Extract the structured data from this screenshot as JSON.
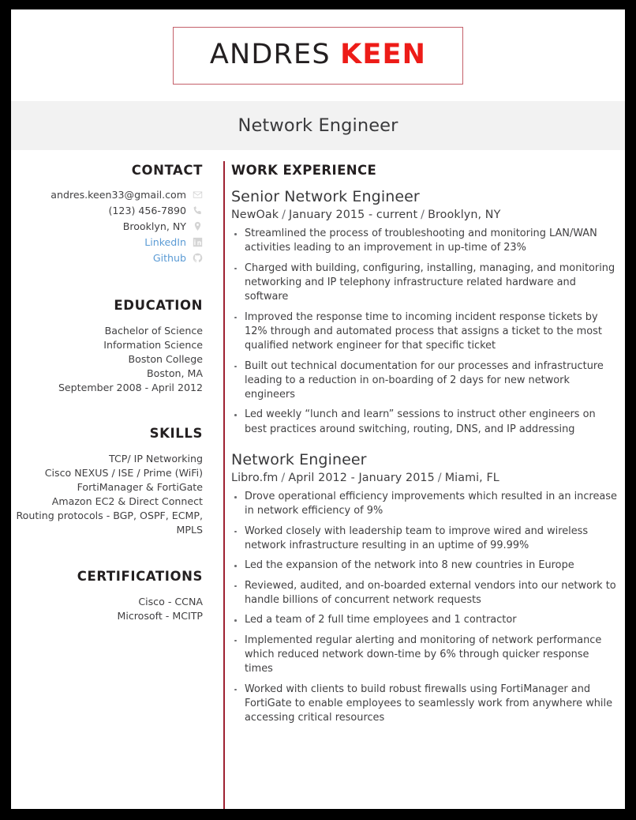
{
  "header": {
    "first_name": "ANDRES",
    "last_name": "KEEN",
    "job_title": "Network Engineer",
    "accent_red": "#ed1c18",
    "box_border": "#c4606a",
    "band_bg": "#f2f2f2"
  },
  "sidebar": {
    "contact": {
      "heading": "CONTACT",
      "items": [
        {
          "text": "andres.keen33@gmail.com",
          "icon": "envelope-icon",
          "is_link": false
        },
        {
          "text": "(123) 456-7890",
          "icon": "phone-icon",
          "is_link": false
        },
        {
          "text": "Brooklyn, NY",
          "icon": "location-pin-icon",
          "is_link": false
        },
        {
          "text": "LinkedIn",
          "icon": "linkedin-icon",
          "is_link": true
        },
        {
          "text": "Github",
          "icon": "github-icon",
          "is_link": true
        }
      ],
      "link_color": "#5b9bd5"
    },
    "education": {
      "heading": "EDUCATION",
      "lines": [
        "Bachelor of Science",
        "Information Science",
        "Boston College",
        "Boston, MA",
        "September 2008 - April 2012"
      ]
    },
    "skills": {
      "heading": "SKILLS",
      "lines": [
        "TCP/ IP Networking",
        "Cisco NEXUS / ISE / Prime (WiFi)",
        "FortiManager & FortiGate",
        "Amazon EC2 & Direct Connect",
        "Routing protocols - BGP, OSPF, ECMP, MPLS"
      ]
    },
    "certifications": {
      "heading": "CERTIFICATIONS",
      "lines": [
        "Cisco - CCNA",
        "Microsoft - MCITP"
      ]
    }
  },
  "main": {
    "heading": "WORK EXPERIENCE",
    "jobs": [
      {
        "role": "Senior Network Engineer",
        "company": "NewOak",
        "dates": "January 2015 - current",
        "location": "Brooklyn, NY",
        "bullets": [
          "Streamlined the process of troubleshooting and monitoring LAN/WAN activities leading to an improvement in up-time of 23%",
          "Charged with building, configuring, installing, managing, and monitoring networking and IP telephony infrastructure related hardware and software",
          "Improved the response time to incoming incident response tickets by 12% through and automated process that assigns a ticket to the most qualified network engineer for that specific ticket",
          "Built out technical documentation for our processes and infrastructure leading to a reduction in on-boarding of 2 days for new network engineers",
          "Led weekly “lunch and learn” sessions to instruct other engineers on best practices around switching, routing, DNS, and IP addressing"
        ]
      },
      {
        "role": "Network Engineer",
        "company": "Libro.fm",
        "dates": "April 2012 - January 2015",
        "location": "Miami, FL",
        "bullets": [
          "Drove operational efficiency improvements which resulted in an increase in network efficiency of 9%",
          "Worked closely with leadership team to improve wired and wireless network infrastructure resulting in an uptime of 99.99%",
          "Led the expansion of the network into 8 new countries in Europe",
          "Reviewed, audited, and on-boarded external vendors into our network to handle billions of concurrent network requests",
          "Led a team of 2 full time employees and 1 contractor",
          "Implemented regular alerting and monitoring of network performance which reduced network down-time by 6% through quicker response times",
          "Worked with clients to build robust firewalls using FortiManager and FortiGate to enable employees to seamlessly work from anywhere while accessing critical resources"
        ]
      }
    ],
    "separator": "/"
  }
}
